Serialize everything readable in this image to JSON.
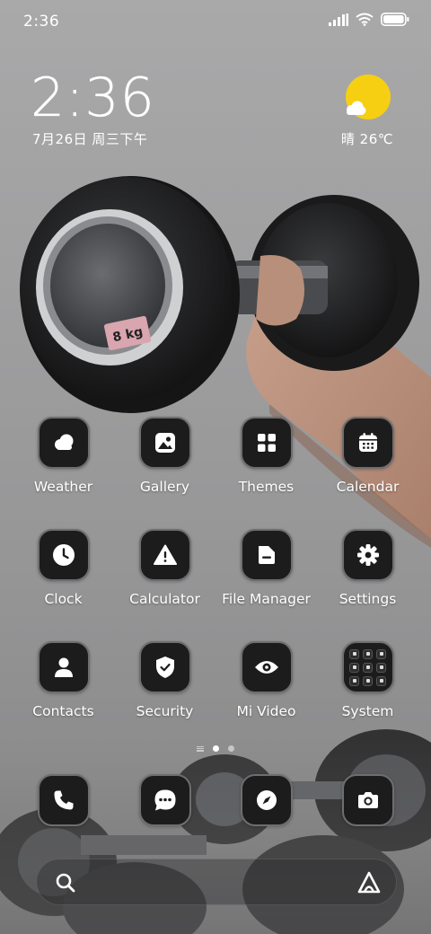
{
  "status_bar": {
    "time": "2:36",
    "icons": [
      "signal-icon",
      "wifi-icon",
      "battery-icon"
    ]
  },
  "clock_widget": {
    "time": "2:36",
    "date": "7月26日 周三下午"
  },
  "weather_widget": {
    "condition_icon": "sun-cloud-icon",
    "text": "晴 26℃"
  },
  "apps": [
    {
      "label": "Weather",
      "icon": "weather-icon"
    },
    {
      "label": "Gallery",
      "icon": "gallery-icon"
    },
    {
      "label": "Themes",
      "icon": "themes-icon"
    },
    {
      "label": "Calendar",
      "icon": "calendar-icon"
    },
    {
      "label": "Clock",
      "icon": "clock-icon"
    },
    {
      "label": "Calculator",
      "icon": "calculator-icon"
    },
    {
      "label": "File Manager",
      "icon": "file-manager-icon"
    },
    {
      "label": "Settings",
      "icon": "settings-icon"
    },
    {
      "label": "Contacts",
      "icon": "contacts-icon"
    },
    {
      "label": "Security",
      "icon": "security-icon"
    },
    {
      "label": "Mi Video",
      "icon": "mi-video-icon"
    },
    {
      "label": "System",
      "icon": "folder-icon"
    }
  ],
  "page_indicator": {
    "pages": 2,
    "active": 1
  },
  "dock": [
    {
      "icon": "phone-icon"
    },
    {
      "icon": "messages-icon"
    },
    {
      "icon": "browser-icon"
    },
    {
      "icon": "camera-icon"
    }
  ],
  "search_bar": {
    "left_icon": "search-icon",
    "right_icon": "assistant-icon"
  },
  "colors": {
    "sun": "#f7cf12",
    "icon_bg": "#1c1c1d",
    "icon_border": "#6e6e70"
  },
  "wallpaper": {
    "dumbbell_label": "8 kg"
  }
}
